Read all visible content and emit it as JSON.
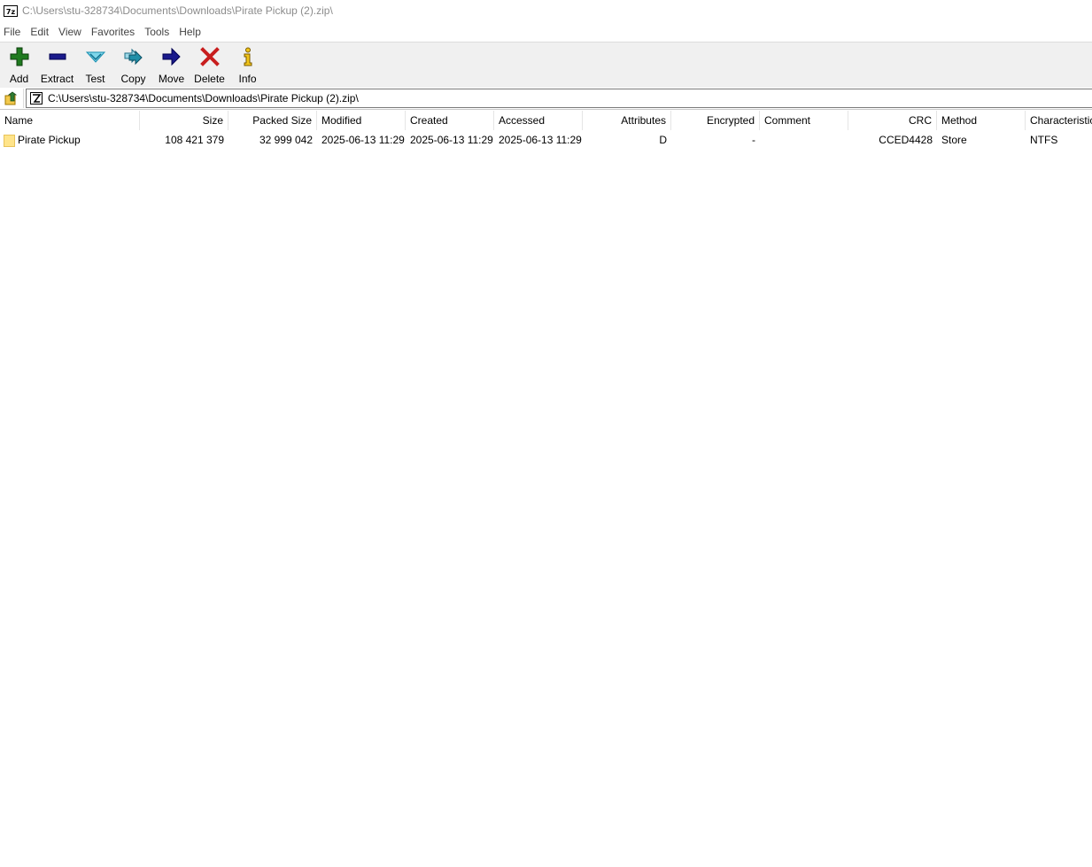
{
  "window": {
    "app_icon_text": "7z",
    "title": "C:\\Users\\stu-328734\\Documents\\Downloads\\Pirate Pickup (2).zip\\"
  },
  "menu": [
    "File",
    "Edit",
    "View",
    "Favorites",
    "Tools",
    "Help"
  ],
  "toolbar": {
    "buttons": [
      {
        "label": "Add",
        "icon": "plus-icon",
        "color": "#1f7a1f"
      },
      {
        "label": "Extract",
        "icon": "minus-icon",
        "color": "#1a1a8c"
      },
      {
        "label": "Test",
        "icon": "checkmark-icon",
        "color": "#22a7c7"
      },
      {
        "label": "Copy",
        "icon": "double-arrow-icon",
        "color": "#1f8fa8"
      },
      {
        "label": "Move",
        "icon": "arrow-right-icon",
        "color": "#1a1a8c"
      },
      {
        "label": "Delete",
        "icon": "x-icon",
        "color": "#c81e1e"
      },
      {
        "label": "Info",
        "icon": "info-icon",
        "color": "#d9a300"
      }
    ]
  },
  "address": {
    "path": "C:\\Users\\stu-328734\\Documents\\Downloads\\Pirate Pickup (2).zip\\"
  },
  "columns": [
    "Name",
    "Size",
    "Packed Size",
    "Modified",
    "Created",
    "Accessed",
    "Attributes",
    "Encrypted",
    "Comment",
    "CRC",
    "Method",
    "Characteristics"
  ],
  "rows": [
    {
      "name": "Pirate Pickup",
      "size": "108 421 379",
      "packed_size": "32 999 042",
      "modified": "2025-06-13 11:29",
      "created": "2025-06-13 11:29",
      "accessed": "2025-06-13 11:29",
      "attributes": "D",
      "encrypted": "-",
      "comment": "",
      "crc": "CCED4428",
      "method": "Store",
      "characteristics": "NTFS"
    }
  ]
}
